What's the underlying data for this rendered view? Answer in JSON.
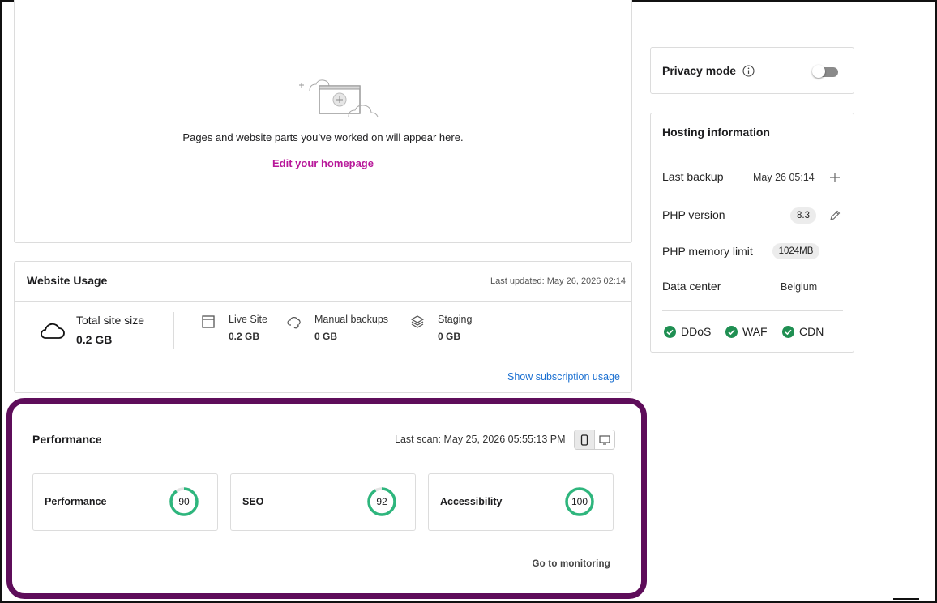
{
  "recent": {
    "empty_message": "Pages and website parts you’ve worked on will appear here.",
    "edit_link": "Edit your homepage"
  },
  "usage": {
    "title": "Website Usage",
    "last_updated": "Last updated: May 26, 2026 02:14",
    "total_label": "Total site size",
    "total_value": "0.2 GB",
    "metrics": [
      {
        "label": "Live Site",
        "value": "0.2 GB",
        "icon": "browser-window-icon"
      },
      {
        "label": "Manual backups",
        "value": "0 GB",
        "icon": "cloud-sync-icon"
      },
      {
        "label": "Staging",
        "value": "0 GB",
        "icon": "layers-icon"
      }
    ],
    "subscription_link": "Show subscription usage"
  },
  "performance": {
    "title": "Performance",
    "last_scan": "Last scan: May 25, 2026 05:55:13 PM",
    "device_selected": "mobile",
    "scores": [
      {
        "label": "Performance",
        "value": "90",
        "fraction": 0.9
      },
      {
        "label": "SEO",
        "value": "92",
        "fraction": 0.92
      },
      {
        "label": "Accessibility",
        "value": "100",
        "fraction": 1.0
      }
    ],
    "goto_link": "Go to monitoring",
    "gauge_color": "#2eb67d",
    "highlight_color": "#5e0d5a"
  },
  "privacy": {
    "label": "Privacy mode",
    "enabled": false
  },
  "hosting": {
    "title": "Hosting information",
    "last_backup_label": "Last backup",
    "last_backup_value": "May 26 05:14",
    "php_version_label": "PHP version",
    "php_version_value": "8.3",
    "php_memory_label": "PHP memory limit",
    "php_memory_value": "1024MB",
    "data_center_label": "Data center",
    "data_center_value": "Belgium",
    "features": [
      "DDoS",
      "WAF",
      "CDN"
    ],
    "feature_color": "#1f8f52"
  }
}
